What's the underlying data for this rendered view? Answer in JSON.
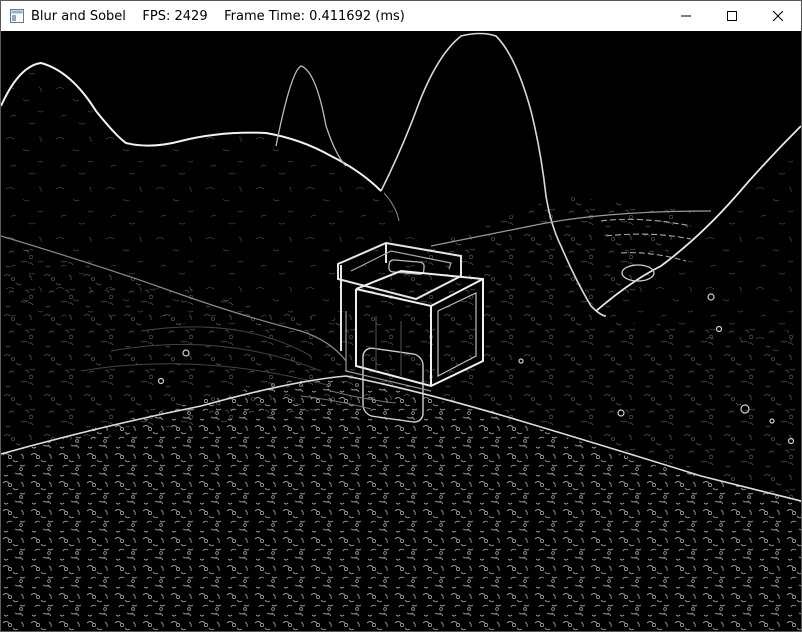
{
  "window": {
    "title": "Blur and Sobel    FPS: 2429    Frame Time: 0.411692 (ms)",
    "icon": "app-window-icon",
    "controls": {
      "minimize_icon": "minimize-icon",
      "maximize_icon": "maximize-icon",
      "close_icon": "close-icon"
    }
  },
  "scene": {
    "description_kind": "sobel-edge-render",
    "background_color": "#000000",
    "edge_color": "#ffffff"
  }
}
